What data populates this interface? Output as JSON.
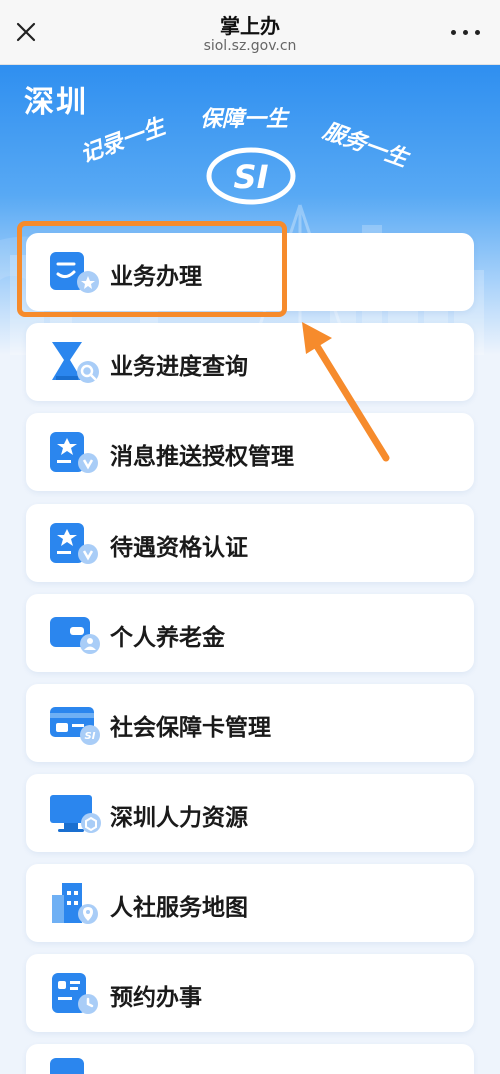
{
  "topbar": {
    "title": "掌上办",
    "url": "siol.sz.gov.cn",
    "close_icon": "close-icon",
    "more_icon": "more-icon"
  },
  "banner": {
    "city": "深圳",
    "slogans": [
      "记录一生",
      "保障一生",
      "服务一生"
    ],
    "logo_text": "SI"
  },
  "menu": {
    "items": [
      {
        "label": "业务办理",
        "icon": "business-handling-icon"
      },
      {
        "label": "业务进度查询",
        "icon": "progress-query-icon"
      },
      {
        "label": "消息推送授权管理",
        "icon": "message-authorization-icon"
      },
      {
        "label": "待遇资格认证",
        "icon": "qualification-certification-icon"
      },
      {
        "label": "个人养老金",
        "icon": "pension-wallet-icon"
      },
      {
        "label": "社会保障卡管理",
        "icon": "social-security-card-icon"
      },
      {
        "label": "深圳人力资源",
        "icon": "monitor-icon"
      },
      {
        "label": "人社服务地图",
        "icon": "service-map-icon"
      },
      {
        "label": "预约办事",
        "icon": "appointment-icon"
      }
    ]
  },
  "colors": {
    "brand_blue": "#2f8ff0",
    "highlight_orange": "#f68b2c",
    "icon_blue": "#2b86ee"
  }
}
